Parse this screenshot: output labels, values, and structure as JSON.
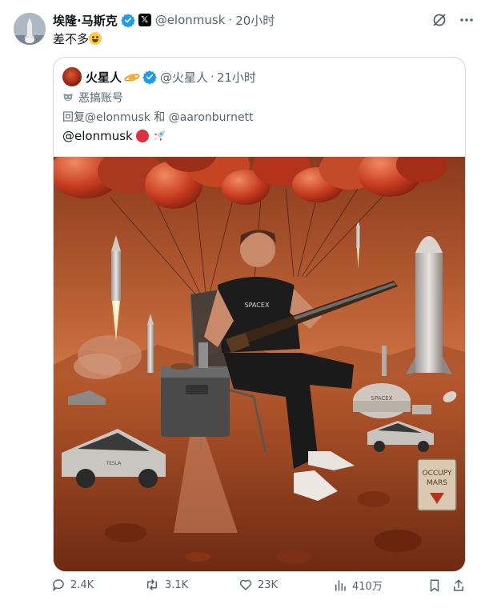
{
  "author": {
    "display_name": "埃隆·马斯克",
    "handle": "@elonmusk",
    "time": "20小时",
    "separator": "·",
    "verified_color": "#1d9bf0"
  },
  "tweet": {
    "text": "差不多"
  },
  "quoted": {
    "display_name": "火星人",
    "handle": "@火星人",
    "time": "21小时",
    "separator": "·",
    "label": "恶搞账号",
    "reply_to": "回复@elonmusk 和 @aaronburnett",
    "text": "@elonmusk",
    "image": {
      "shirt_text": "SPACEX",
      "dome_text": "SPACEX",
      "sign_text_line1": "OCCUPY",
      "sign_text_line2": "MARS",
      "car_text": "TESLA"
    }
  },
  "actions": {
    "reply_count": "2.4K",
    "retweet_count": "3.1K",
    "like_count": "23K",
    "view_count": "410万"
  },
  "icons": [
    "grok-icon",
    "more-icon",
    "verified-badge-icon",
    "x-badge-icon",
    "laughing-emoji-icon",
    "mask-icon",
    "red-circle-emoji-icon",
    "rocket-emoji-icon",
    "reply-icon",
    "retweet-icon",
    "like-icon",
    "views-icon",
    "bookmark-icon",
    "share-icon"
  ]
}
